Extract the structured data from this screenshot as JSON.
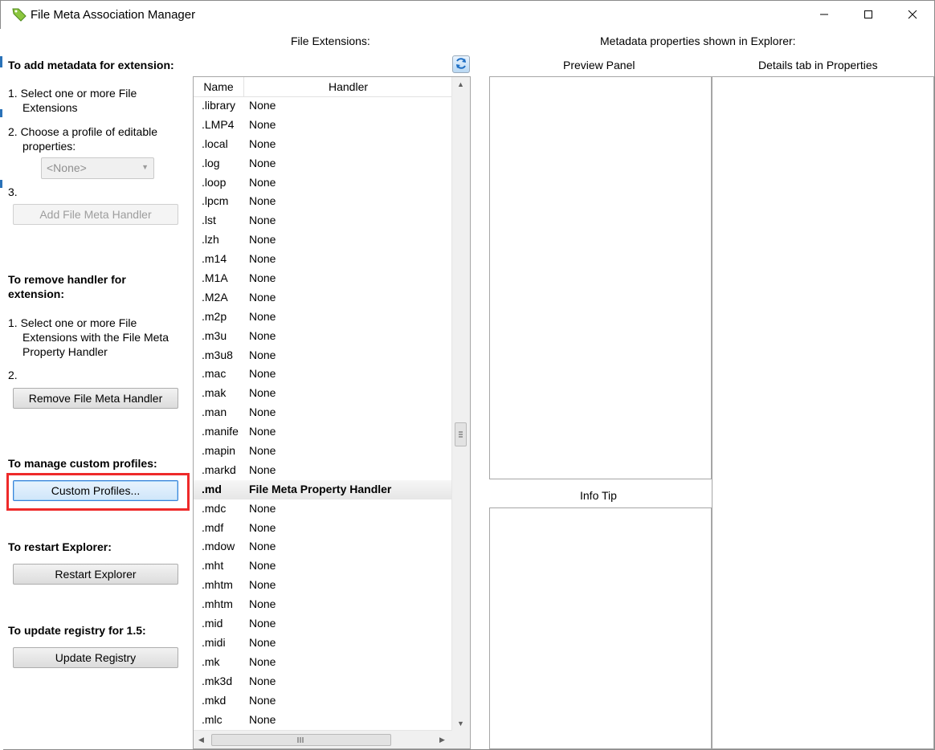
{
  "window": {
    "title": "File Meta Association Manager",
    "minimize_icon": "minimize-icon",
    "maximize_icon": "maximize-icon",
    "close_icon": "close-icon"
  },
  "left": {
    "add_heading": "To add metadata for extension:",
    "step1": "1. Select one or more File",
    "step1b": "Extensions",
    "step2": "2. Choose a profile of editable",
    "step2b": "properties:",
    "profile_combo": "<None>",
    "step3": "3.",
    "add_button": "Add File Meta Handler",
    "remove_heading_1": "To remove handler for",
    "remove_heading_2": "extension:",
    "rstep1": "1. Select one or more File",
    "rstep1b": "Extensions with the File Meta",
    "rstep1c": "Property Handler",
    "rstep2": "2.",
    "remove_button": "Remove File Meta Handler",
    "profiles_heading": "To manage custom profiles:",
    "profiles_button": "Custom Profiles...",
    "restart_heading": "To restart Explorer:",
    "restart_button": "Restart Explorer",
    "update_heading": "To update registry for 1.5:",
    "update_button": "Update Registry"
  },
  "middle": {
    "heading": "File Extensions:",
    "refresh_icon": "refresh-icon",
    "columns": {
      "name": "Name",
      "handler": "Handler"
    },
    "rows": [
      {
        "name": ".library",
        "handler": "None"
      },
      {
        "name": ".LMP4",
        "handler": "None"
      },
      {
        "name": ".local",
        "handler": "None"
      },
      {
        "name": ".log",
        "handler": "None"
      },
      {
        "name": ".loop",
        "handler": "None"
      },
      {
        "name": ".lpcm",
        "handler": "None"
      },
      {
        "name": ".lst",
        "handler": "None"
      },
      {
        "name": ".lzh",
        "handler": "None"
      },
      {
        "name": ".m14",
        "handler": "None"
      },
      {
        "name": ".M1A",
        "handler": "None"
      },
      {
        "name": ".M2A",
        "handler": "None"
      },
      {
        "name": ".m2p",
        "handler": "None"
      },
      {
        "name": ".m3u",
        "handler": "None"
      },
      {
        "name": ".m3u8",
        "handler": "None"
      },
      {
        "name": ".mac",
        "handler": "None"
      },
      {
        "name": ".mak",
        "handler": "None"
      },
      {
        "name": ".man",
        "handler": "None"
      },
      {
        "name": ".manife",
        "handler": "None"
      },
      {
        "name": ".mapin",
        "handler": "None"
      },
      {
        "name": ".markd",
        "handler": "None"
      },
      {
        "name": ".md",
        "handler": "File Meta Property Handler",
        "selected": true
      },
      {
        "name": ".mdc",
        "handler": "None"
      },
      {
        "name": ".mdf",
        "handler": "None"
      },
      {
        "name": ".mdow",
        "handler": "None"
      },
      {
        "name": ".mht",
        "handler": "None"
      },
      {
        "name": ".mhtm",
        "handler": "None"
      },
      {
        "name": ".mhtm",
        "handler": "None"
      },
      {
        "name": ".mid",
        "handler": "None"
      },
      {
        "name": ".midi",
        "handler": "None"
      },
      {
        "name": ".mk",
        "handler": "None"
      },
      {
        "name": ".mk3d",
        "handler": "None"
      },
      {
        "name": ".mkd",
        "handler": "None"
      },
      {
        "name": ".mlc",
        "handler": "None"
      }
    ]
  },
  "right": {
    "heading": "Metadata properties shown in Explorer:",
    "preview_label": "Preview Panel",
    "details_label": "Details tab in Properties",
    "infotip_label": "Info Tip"
  }
}
